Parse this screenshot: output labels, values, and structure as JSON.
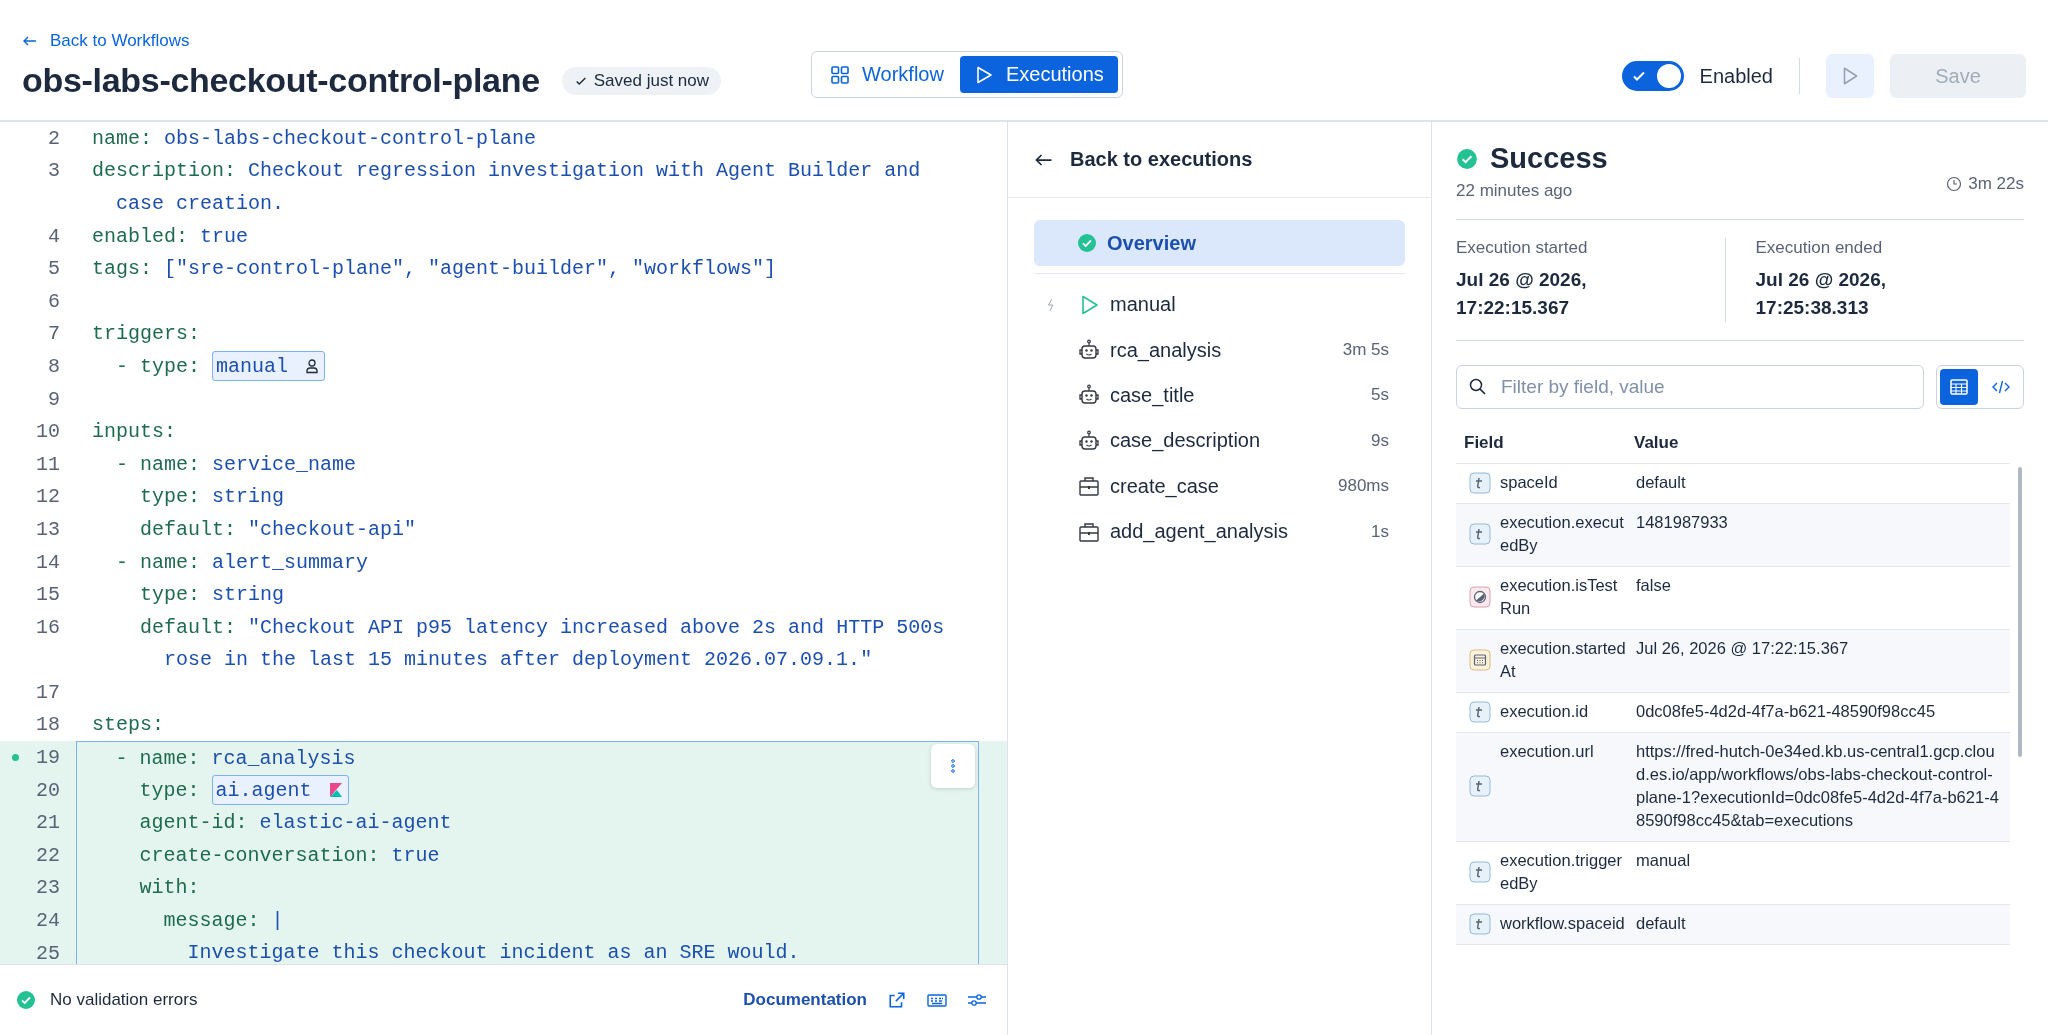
{
  "header": {
    "back_link": "Back to Workflows",
    "title": "obs-labs-checkout-control-plane",
    "save_status": "Saved just now",
    "tabs": [
      {
        "label": "Workflow",
        "selected": false
      },
      {
        "label": "Executions",
        "selected": true
      }
    ],
    "enabled_toggle": {
      "label": "Enabled",
      "on": true
    },
    "save_button": {
      "label": "Save",
      "disabled": true
    }
  },
  "editor": {
    "lines": [
      {
        "kind": "code",
        "number": "2",
        "key": "name:",
        "value": "obs-labs-checkout-control-plane",
        "highlighted": false,
        "marked": false
      },
      {
        "kind": "code",
        "number": "3",
        "key": "description:",
        "value": "Checkout regression investigation with Agent Builder and",
        "highlighted": false,
        "marked": false
      },
      {
        "kind": "code",
        "value": "  case creation.",
        "highlighted": false,
        "marked": false
      },
      {
        "kind": "code",
        "number": "4",
        "key": "enabled:",
        "value": "true",
        "highlighted": false,
        "marked": false
      },
      {
        "kind": "code",
        "number": "5",
        "key": "tags:",
        "value": "[\"sre-control-plane\", \"agent-builder\", \"workflows\"]",
        "highlighted": false,
        "marked": false
      },
      {
        "kind": "code",
        "number": "6",
        "highlighted": false,
        "marked": false
      },
      {
        "kind": "code",
        "number": "7",
        "key": "triggers:",
        "highlighted": false,
        "marked": false
      },
      {
        "kind": "trigger_badge",
        "number": "8",
        "key": "  - type:",
        "value": "manual",
        "highlighted": false,
        "marked": false
      },
      {
        "kind": "code",
        "number": "9",
        "highlighted": false,
        "marked": false
      },
      {
        "kind": "code",
        "number": "10",
        "key": "inputs:",
        "highlighted": false,
        "marked": false
      },
      {
        "kind": "code",
        "number": "11",
        "key": "  - name:",
        "value": "service_name",
        "highlighted": false,
        "marked": false
      },
      {
        "kind": "code",
        "number": "12",
        "key": "    type:",
        "value": "string",
        "highlighted": false,
        "marked": false
      },
      {
        "kind": "code",
        "number": "13",
        "key": "    default:",
        "value": "\"checkout-api\"",
        "highlighted": false,
        "marked": false
      },
      {
        "kind": "code",
        "number": "14",
        "key": "  - name:",
        "value": "alert_summary",
        "highlighted": false,
        "marked": false
      },
      {
        "kind": "code",
        "number": "15",
        "key": "    type:",
        "value": "string",
        "highlighted": false,
        "marked": false
      },
      {
        "kind": "code",
        "number": "16",
        "key": "    default:",
        "value": "\"Checkout API p95 latency increased above 2s and HTTP 500s",
        "highlighted": false,
        "marked": false
      },
      {
        "kind": "code",
        "value": "      rose in the last 15 minutes after deployment 2026.07.09.1.\"",
        "highlighted": false,
        "marked": false
      },
      {
        "kind": "code",
        "number": "17",
        "highlighted": false,
        "marked": false
      },
      {
        "kind": "code",
        "number": "18",
        "key": "steps:",
        "highlighted": false,
        "marked": false
      },
      {
        "kind": "code",
        "number": "19",
        "key": "  - name:",
        "value": "rca_analysis",
        "highlighted": true,
        "marked": true
      },
      {
        "kind": "agent_badge",
        "number": "20",
        "key": "    type:",
        "value": "ai.agent",
        "highlighted": true,
        "marked": false
      },
      {
        "kind": "code",
        "number": "21",
        "key": "    agent-id:",
        "value": "elastic-ai-agent",
        "highlighted": true,
        "marked": false
      },
      {
        "kind": "code",
        "number": "22",
        "key": "    create-conversation:",
        "value": "true",
        "highlighted": true,
        "marked": false
      },
      {
        "kind": "code",
        "number": "23",
        "key": "    with:",
        "highlighted": true,
        "marked": false
      },
      {
        "kind": "code",
        "number": "24",
        "key": "      message:",
        "value": "|",
        "highlighted": true,
        "marked": false
      },
      {
        "kind": "code",
        "number": "25",
        "value": "        Investigate this checkout incident as an SRE would.",
        "highlighted": true,
        "marked": false
      }
    ],
    "footer": {
      "validation": "No validation errors",
      "valid": true,
      "documentation_link": "Documentation"
    }
  },
  "executions_panel": {
    "back_link": "Back to executions",
    "overview": {
      "label": "Overview",
      "selected": true
    },
    "steps": [
      {
        "kind": "trigger",
        "name": "manual",
        "selected": false
      },
      {
        "kind": "agent",
        "name": "rca_analysis",
        "duration": "3m 5s",
        "selected": false
      },
      {
        "kind": "agent",
        "name": "case_title",
        "duration": "5s",
        "selected": false
      },
      {
        "kind": "agent",
        "name": "case_description",
        "duration": "9s",
        "selected": false
      },
      {
        "kind": "connector",
        "name": "create_case",
        "duration": "980ms",
        "selected": false
      },
      {
        "kind": "connector",
        "name": "add_agent_analysis",
        "duration": "1s",
        "selected": false
      }
    ]
  },
  "execution": {
    "status": "Success",
    "ago": "22 minutes ago",
    "duration": "3m 22s",
    "started": {
      "label": "Execution started",
      "date": "Jul 26 @ 2026,",
      "time": "17:22:15.367"
    },
    "ended": {
      "label": "Execution ended",
      "date": "Jul 26 @ 2026,",
      "time": "17:25:38.313"
    },
    "filter": {
      "placeholder": "Filter by field, value"
    },
    "view_modes": [
      {
        "kind": "table",
        "selected": true
      },
      {
        "kind": "json",
        "selected": false
      }
    ],
    "table": {
      "columns": [
        "Field",
        "Value"
      ],
      "rows": [
        {
          "kind": "string",
          "field": "spaceId",
          "value": "default"
        },
        {
          "kind": "string",
          "field": "execution.executedBy",
          "value": "1481987933"
        },
        {
          "kind": "boolean",
          "field": "execution.isTestRun",
          "value": "false"
        },
        {
          "kind": "date",
          "field": "execution.startedAt",
          "value": "Jul 26, 2026 @ 17:22:15.367"
        },
        {
          "kind": "string",
          "field": "execution.id",
          "value": "0dc08fe5-4d2d-4f7a-b621-48590f98cc45"
        },
        {
          "kind": "string",
          "field": "execution.url",
          "value": "https://fred-hutch-0e34ed.kb.us-central1.gcp.cloud.es.io/app/workflows/obs-labs-checkout-control-plane-1?executionId=0dc08fe5-4d2d-4f7a-b621-48590f98cc45&tab=executions"
        },
        {
          "kind": "string",
          "field": "execution.triggeredBy",
          "value": "manual"
        },
        {
          "kind": "string",
          "field": "workflow.spaceid",
          "value": "default"
        }
      ]
    }
  }
}
